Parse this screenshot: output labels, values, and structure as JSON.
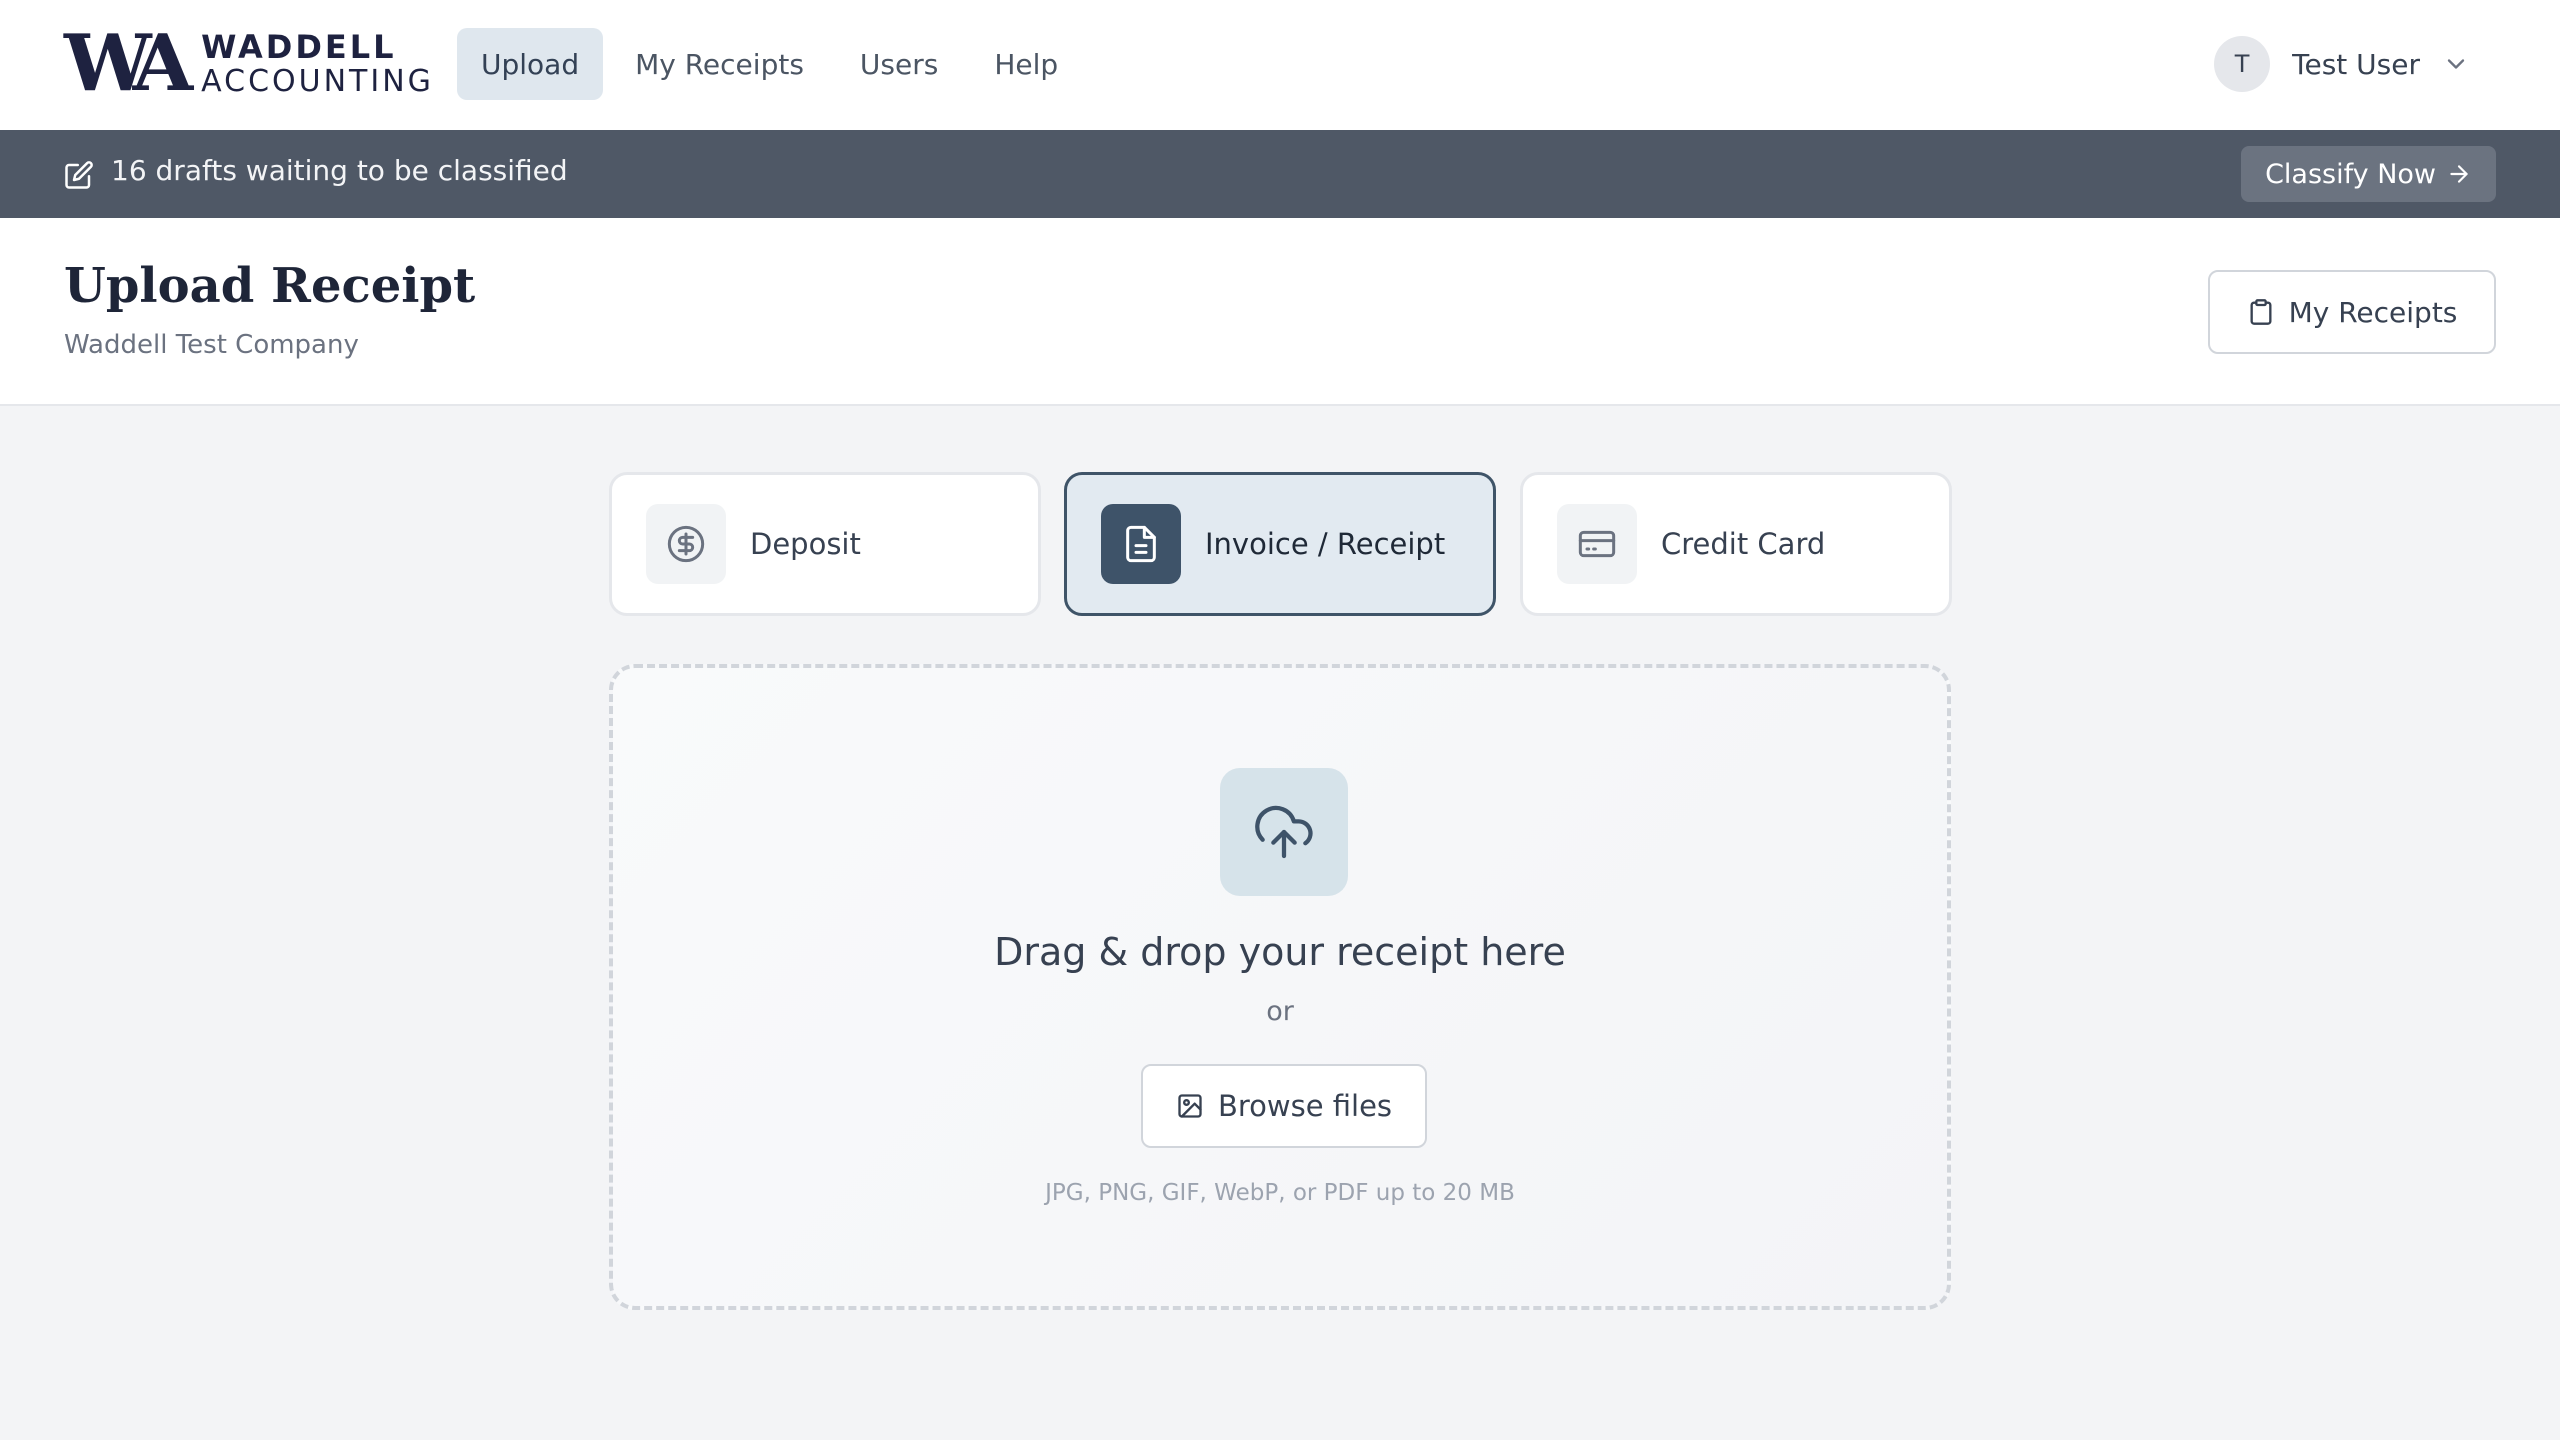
{
  "brand": {
    "mark": "WA",
    "line1": "WADDELL",
    "line2": "ACCOUNTING"
  },
  "nav": {
    "items": [
      {
        "label": "Upload",
        "active": true
      },
      {
        "label": "My Receipts",
        "active": false
      },
      {
        "label": "Users",
        "active": false
      },
      {
        "label": "Help",
        "active": false
      }
    ]
  },
  "user": {
    "initial": "T",
    "name": "Test User"
  },
  "banner": {
    "text": "16 drafts waiting to be classified",
    "button_label": "Classify Now"
  },
  "header": {
    "title": "Upload Receipt",
    "subtitle": "Waddell Test Company",
    "my_receipts_label": "My Receipts"
  },
  "types": [
    {
      "label": "Deposit",
      "icon": "dollar-circle-icon",
      "active": false
    },
    {
      "label": "Invoice / Receipt",
      "icon": "document-icon",
      "active": true
    },
    {
      "label": "Credit Card",
      "icon": "credit-card-icon",
      "active": false
    }
  ],
  "dropzone": {
    "title": "Drag & drop your receipt here",
    "or": "or",
    "browse_label": "Browse files",
    "hint": "JPG, PNG, GIF, WebP, or PDF up to 20 MB"
  },
  "colors": {
    "banner_bg": "#4f5866",
    "accent": "#3e5369",
    "active_bg": "#e2eaf1"
  }
}
